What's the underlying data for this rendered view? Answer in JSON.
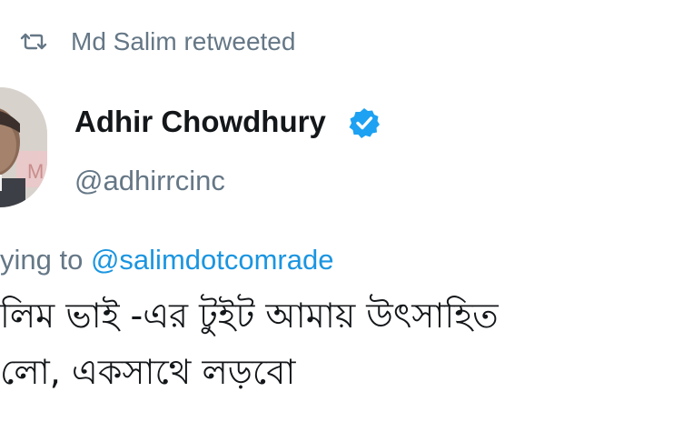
{
  "retweet": {
    "icon": "retweet-icon",
    "text": "Md Salim retweeted"
  },
  "author": {
    "name": "Adhir Chowdhury",
    "verified_icon": "verified-badge-icon",
    "handle": "@adhirrcinc"
  },
  "reply": {
    "prefix": "ying to",
    "mention": "@salimdotcomrade"
  },
  "tweet": {
    "lines": [
      "লিম ভাই -এর টুইট আমায় উৎসাহিত",
      "লো, একসাথে লড়বো"
    ]
  },
  "colors": {
    "secondary_text": "#657786",
    "link": "#1b95e0",
    "verified": "#1da1f2",
    "primary_text": "#14171a"
  }
}
